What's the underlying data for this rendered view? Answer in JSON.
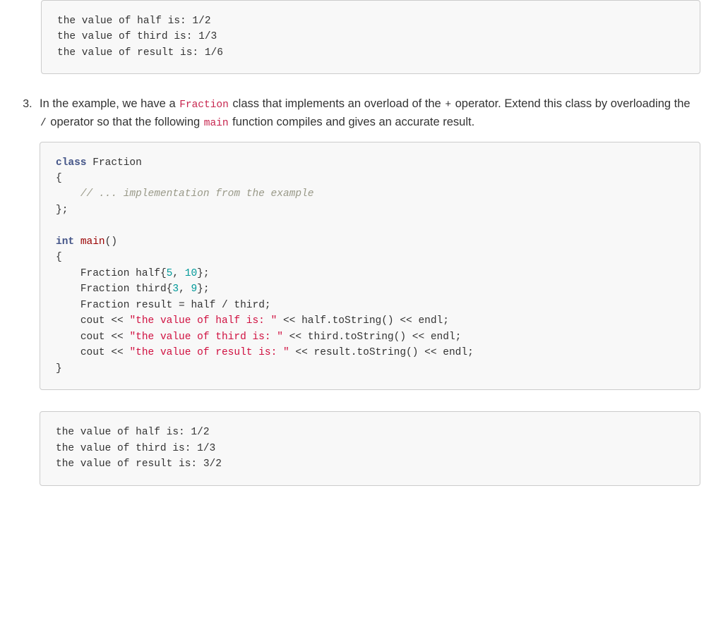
{
  "output1": {
    "line1": "the value of half is: 1/2",
    "line2": "the value of third is: 1/3",
    "line3": "the value of result is: 1/6"
  },
  "exercise": {
    "number": "3",
    "text_parts": {
      "p1": "In the example, we have a ",
      "fraction": "Fraction",
      "p2": " class that implements an overload of the ",
      "plus": "+",
      "p3": " operator. Extend this class by overloading the ",
      "slash": "/",
      "p4": " operator so that the following ",
      "mainfn": "main",
      "p5": " function compiles and gives an accurate result."
    }
  },
  "code": {
    "kw_class": "class",
    "Fraction": "Fraction",
    "lbrace": "{",
    "comment_impl": "// ... implementation from the example",
    "rbrace_semi": "};",
    "kw_int": "int",
    "main": "main",
    "parens": "()",
    "half": "half",
    "half_init_open": "{",
    "n5": "5",
    "comma_sp": ", ",
    "n10": "10",
    "brace_close_semi": "};",
    "third": "third",
    "n3": "3",
    "n9": "9",
    "result": "result",
    "eq": " = ",
    "div": " / ",
    "semi": ";",
    "cout": "cout",
    "llt": " << ",
    "str_half": "\"the value of half is: \"",
    "str_third": "\"the value of third is: \"",
    "str_result": "\"the value of result is: \"",
    "dot": ".",
    "toString": "toString",
    "call": "()",
    "endl": "endl",
    "rbrace": "}"
  },
  "output2": {
    "line1": "the value of half is: 1/2",
    "line2": "the value of third is: 1/3",
    "line3": "the value of result is: 3/2"
  }
}
